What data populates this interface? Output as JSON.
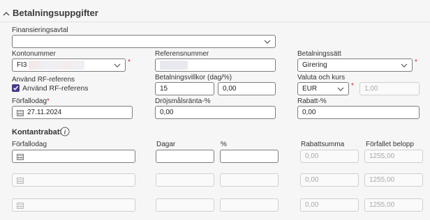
{
  "header": {
    "title": "Betalningsuppgifter"
  },
  "financing": {
    "label": "Finansieringsavtal",
    "value": ""
  },
  "account": {
    "label": "Kontonummer",
    "value": "FI3"
  },
  "reference": {
    "label": "Referensnummer",
    "value": ""
  },
  "payment_method": {
    "label": "Betalningssätt",
    "value": "Girering"
  },
  "rf": {
    "label": "Använd RF-referens",
    "checkbox_label": "Använd RF-referens",
    "checked": true
  },
  "terms": {
    "label": "Betalningsvillkor (dag/%)",
    "days": "15",
    "percent": "0,00"
  },
  "currency": {
    "label": "Valuta och kurs",
    "value": "EUR",
    "rate": "1,00"
  },
  "due_date": {
    "label": "Förfallodag",
    "value": "27.11.2024"
  },
  "penalty": {
    "label": "Dröjsmålsränta-%",
    "value": "0,00"
  },
  "discount": {
    "label": "Rabatt-%",
    "value": "0,00"
  },
  "cash_discount": {
    "title": "Kontantrabatt",
    "headers": {
      "due": "Förfallodag",
      "days": "Dagar",
      "pct": "%",
      "sum": "Rabattsumma",
      "due_amount": "Förfallet belopp"
    },
    "rows": [
      {
        "sum": "0,00",
        "due_amount": "1255,00"
      },
      {
        "sum": "0,00",
        "due_amount": "1255,00"
      },
      {
        "sum": "0,00",
        "due_amount": "1255,00"
      }
    ]
  },
  "required_mark": "*",
  "colors": {
    "border": "#7d7d7d",
    "required": "#d0242b",
    "checkbox": "#4a3a8a"
  }
}
